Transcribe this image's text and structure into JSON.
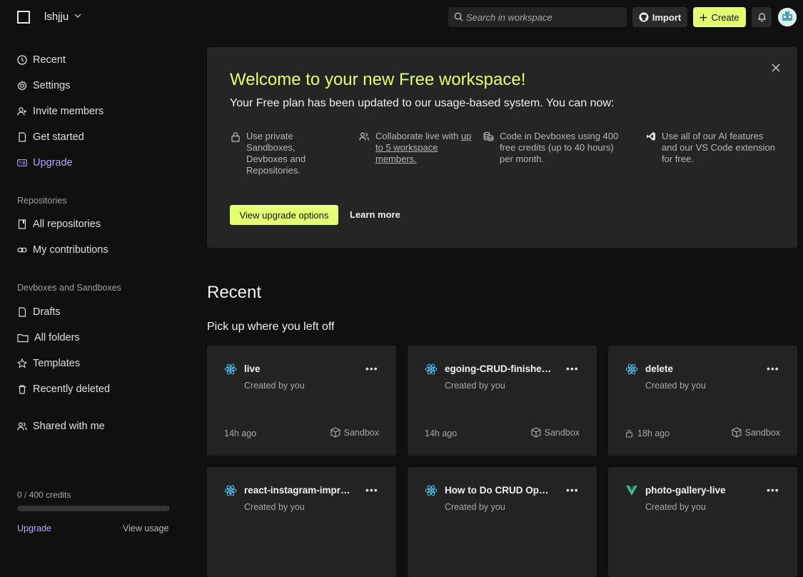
{
  "header": {
    "workspace_name": "lshjju",
    "search_placeholder": "Search in workspace",
    "import_label": "Import",
    "create_label": "Create"
  },
  "sidebar": {
    "main_items": [
      {
        "label": "Recent",
        "icon": "clock-icon"
      },
      {
        "label": "Settings",
        "icon": "gear-icon"
      },
      {
        "label": "Invite members",
        "icon": "user-plus-icon"
      },
      {
        "label": "Get started",
        "icon": "document-icon"
      },
      {
        "label": "Upgrade",
        "icon": "pro-badge-icon"
      }
    ],
    "repos_heading": "Repositories",
    "repo_items": [
      {
        "label": "All repositories",
        "icon": "repository-icon"
      },
      {
        "label": "My contributions",
        "icon": "link-icon"
      }
    ],
    "devbox_heading": "Devboxes and Sandboxes",
    "devbox_items": [
      {
        "label": "Drafts",
        "icon": "document-icon"
      },
      {
        "label": "All folders",
        "icon": "folder-icon"
      },
      {
        "label": "Templates",
        "icon": "star-icon"
      },
      {
        "label": "Recently deleted",
        "icon": "trash-icon"
      }
    ],
    "shared_label": "Shared with me",
    "credits_text": "0 / 400 credits",
    "credits_used_fraction": 0,
    "upgrade_link": "Upgrade",
    "view_usage_link": "View usage"
  },
  "banner": {
    "title": "Welcome to your new Free workspace!",
    "subtitle": "Your Free plan has been updated to our usage-based system. You can now:",
    "features": [
      {
        "icon": "lock-icon",
        "text": "Use private Sandboxes, Devboxes and Repositories."
      },
      {
        "icon": "users-icon",
        "text_before": "Collaborate live with ",
        "link": "up to 5 workspace members."
      },
      {
        "icon": "coins-icon",
        "text": "Code in Devboxes using 400 free credits (up to 40 hours) per month."
      },
      {
        "icon": "vscode-icon",
        "text": "Use all of our AI features and our VS Code extension for free."
      }
    ],
    "primary_button": "View upgrade options",
    "secondary_button": "Learn more"
  },
  "recent": {
    "title": "Recent",
    "subtitle": "Pick up where you left off",
    "cards": [
      {
        "title": "live",
        "creator": "Created by you",
        "time": "14h ago",
        "type": "Sandbox",
        "icon": "react-icon",
        "locked": false
      },
      {
        "title": "egoing-CRUD-finished-v...",
        "creator": "Created by you",
        "time": "14h ago",
        "type": "Sandbox",
        "icon": "react-icon",
        "locked": false
      },
      {
        "title": "delete",
        "creator": "Created by you",
        "time": "18h ago",
        "type": "Sandbox",
        "icon": "react-icon",
        "locked": true
      },
      {
        "title": "react-instagram-improv...",
        "creator": "Created by you",
        "time": "",
        "type": "",
        "icon": "react-icon",
        "locked": false
      },
      {
        "title": "How to Do CRUD Operat...",
        "creator": "Created by you",
        "time": "",
        "type": "",
        "icon": "react-icon",
        "locked": false
      },
      {
        "title": "photo-gallery-live",
        "creator": "Created by you",
        "time": "",
        "type": "",
        "icon": "vue-icon",
        "locked": false
      }
    ],
    "more_glyph": "•••"
  },
  "colors": {
    "accent_lime": "#e3ff73",
    "accent_purple": "#b6a5ff",
    "react_blue": "#4fc3f7",
    "vue_green": "#41b883",
    "background": "#0f0f0f",
    "card_bg": "#232323"
  }
}
